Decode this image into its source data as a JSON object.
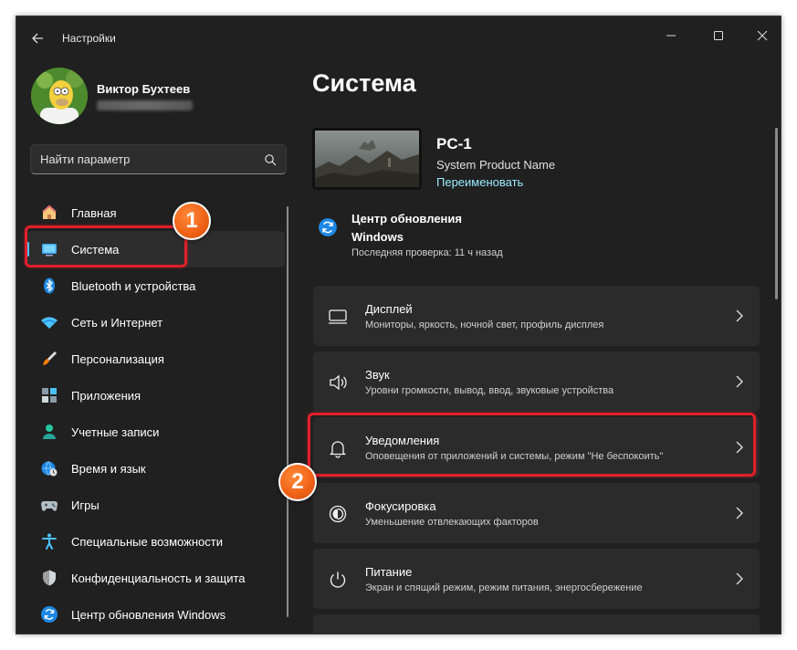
{
  "window": {
    "title": "Настройки"
  },
  "profile": {
    "name": "Виктор Бухтеев"
  },
  "search": {
    "placeholder": "Найти параметр"
  },
  "sidebar": {
    "items": [
      {
        "label": "Главная",
        "icon": "home-icon"
      },
      {
        "label": "Система",
        "icon": "display-icon",
        "active": true
      },
      {
        "label": "Bluetooth и устройства",
        "icon": "bluetooth-icon"
      },
      {
        "label": "Сеть и Интернет",
        "icon": "wifi-icon"
      },
      {
        "label": "Персонализация",
        "icon": "brush-icon"
      },
      {
        "label": "Приложения",
        "icon": "apps-icon"
      },
      {
        "label": "Учетные записи",
        "icon": "user-icon"
      },
      {
        "label": "Время и язык",
        "icon": "globe-clock-icon"
      },
      {
        "label": "Игры",
        "icon": "gamepad-icon"
      },
      {
        "label": "Специальные возможности",
        "icon": "accessibility-icon"
      },
      {
        "label": "Конфиденциальность и защита",
        "icon": "shield-icon"
      },
      {
        "label": "Центр обновления Windows",
        "icon": "update-icon"
      }
    ]
  },
  "main": {
    "title": "Система",
    "pc": {
      "name": "PC-1",
      "model": "System Product Name",
      "rename": "Переименовать"
    },
    "update": {
      "title": "Центр обновления Windows",
      "subtitle": "Последняя проверка: 11 ч назад"
    },
    "cards": [
      {
        "title": "Дисплей",
        "subtitle": "Мониторы, яркость, ночной свет, профиль дисплея",
        "icon": "monitor-icon"
      },
      {
        "title": "Звук",
        "subtitle": "Уровни громкости, вывод, ввод, звуковые устройства",
        "icon": "speaker-icon"
      },
      {
        "title": "Уведомления",
        "subtitle": "Оповещения от приложений и системы, режим \"Не беспокоить\"",
        "icon": "bell-icon"
      },
      {
        "title": "Фокусировка",
        "subtitle": "Уменьшение отвлекающих факторов",
        "icon": "focus-icon"
      },
      {
        "title": "Питание",
        "subtitle": "Экран и спящий режим, режим питания, энергосбережение",
        "icon": "power-icon"
      }
    ]
  },
  "annotations": {
    "badge1": "1",
    "badge2": "2"
  },
  "colors": {
    "accent": "#4cc2ff",
    "link": "#99ebff",
    "highlight": "#e0202a",
    "badge": "#f06418"
  }
}
